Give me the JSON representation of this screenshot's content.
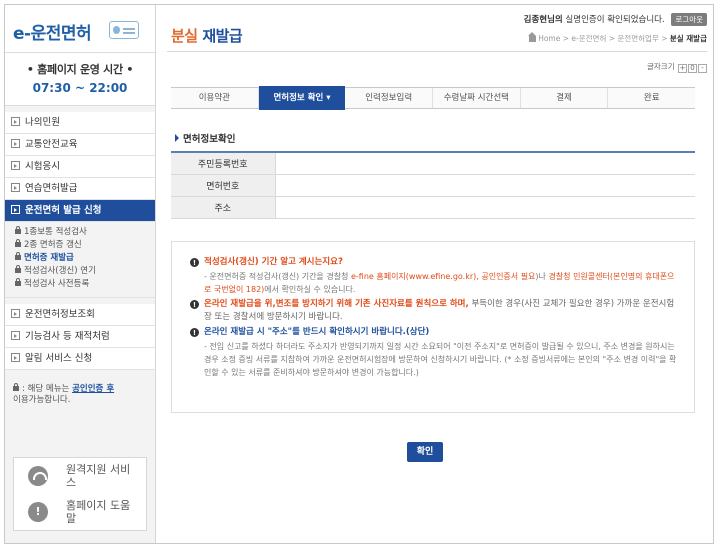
{
  "sidebar": {
    "logo": "e-운전면허",
    "hours_title": "• 홈페이지 운영 시간 •",
    "hours_time": "07:30 ~ 22:00",
    "menu_top": [
      {
        "label": "나의민원"
      },
      {
        "label": "교통안전교육"
      },
      {
        "label": "시험응시"
      },
      {
        "label": "연습면허발급"
      },
      {
        "label": "운전면허 발급 신청",
        "active": true
      }
    ],
    "submenu": [
      {
        "label": "1종보통 적성검사"
      },
      {
        "label": "2종 면허증 갱신"
      },
      {
        "label": "면허증 재발급",
        "current": true
      },
      {
        "label": "적성검사(갱신) 연기"
      },
      {
        "label": "적성검사 사전등록"
      }
    ],
    "menu_bottom": [
      {
        "label": "운전면허정보조회"
      },
      {
        "label": "기능검사 등 재적처럼"
      },
      {
        "label": "알림 서비스 신청"
      }
    ],
    "note_prefix": ": 해당 메뉴는 ",
    "note_cert": "공인인증 후",
    "note_suffix": "이용가능합니다.",
    "services": [
      {
        "label": "원격지원 서비스",
        "icon": "wifi-icon"
      },
      {
        "label": "홈페이지 도움말",
        "icon": "info-icon"
      }
    ]
  },
  "header": {
    "title_accent": "분실",
    "title_rest": " 재발급",
    "login_name": "김종현님의",
    "login_text": " 실명인증이 확인되었습니다.",
    "logout_label": "로그아웃",
    "breadcrumb": [
      "Home",
      "e-운전면허",
      "운전면허업무"
    ],
    "breadcrumb_last": "분실 재발급",
    "fontsize_label": "글자크기",
    "fontsize_buttons": [
      "+",
      "0",
      "-"
    ]
  },
  "steps": [
    {
      "label": "이용약관"
    },
    {
      "label": "면허정보 확인 ▾",
      "active": true
    },
    {
      "label": "인력정보입력"
    },
    {
      "label": "수령날짜 시간선택"
    },
    {
      "label": "결제"
    },
    {
      "label": "완료"
    }
  ],
  "section_title": "면허정보확인",
  "info_rows": [
    {
      "label": "주민등록번호",
      "value": ""
    },
    {
      "label": "면허번호",
      "value": ""
    },
    {
      "label": "주소",
      "value": ""
    }
  ],
  "notice": {
    "item1_head": "적성검사(갱신) 기간 알고 계시는지요?",
    "item1_sub_a": "- 운전면허증 적성검사(갱신) 기간을 경찰청 ",
    "item1_sub_b": "e-fine 홈페이지(www.efine.go.kr), 공인인증서 필요",
    "item1_sub_c": ")나 ",
    "item1_sub_d": "경찰청 민원콜센터(본인명의 휴대폰으로 국번없이 182)",
    "item1_sub_e": "에서 확인하실 수 있습니다.",
    "item2_head": "온라인 재발급을 위,변조를 방지하기 위해 기존 사진자료를 원칙으로 하며,",
    "item2_rest": " 부득이한 경우(사진 교체가 필요한 경우) 가까운 운전시험장 또는 경찰서에 방문하시기 바랍니다.",
    "item3_head": "온라인 재발급 시 \"주소\"를 반드시 확인하시기 바랍니다.(상단)",
    "item3_sub": "- 전입 신고를 하셨다 하더라도 주소지가 반영되기까지 일정 시간 소요되어 \"이전 주소지\"로 면허증이 발급될 수 있으니, 주소 변경을 원하시는 경우 소정 증빙 서류를 지참하여 가까운 운전면허시험장에 방문하여 신청하시기 바랍니다. (* 소정 증빙서류에는 본인의 \"주소 변경 이력\"을 확인할 수 있는 서류를 준비하셔야 방문하셔야 변경이 가능합니다.)"
  },
  "ok_label": "확인"
}
